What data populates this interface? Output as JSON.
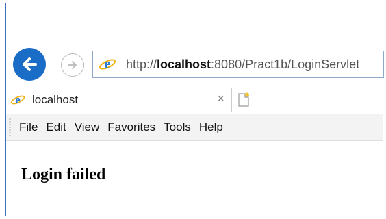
{
  "browser": {
    "address": {
      "prefix": "http://",
      "host": "localhost",
      "rest": ":8080/Pract1b/LoginServlet"
    },
    "tab": {
      "title": "localhost",
      "close_glyph": "×"
    },
    "menu": [
      "File",
      "Edit",
      "View",
      "Favorites",
      "Tools",
      "Help"
    ],
    "icons": {
      "back": "back-arrow-icon",
      "forward": "forward-arrow-icon",
      "site": "internet-explorer-icon",
      "new_tab": "new-tab-icon"
    },
    "colors": {
      "back_button": "#1a6dc6",
      "frame_border": "#3f6fb8",
      "menu_bg": "#f3f3f3"
    }
  },
  "page": {
    "heading": "Login failed"
  }
}
